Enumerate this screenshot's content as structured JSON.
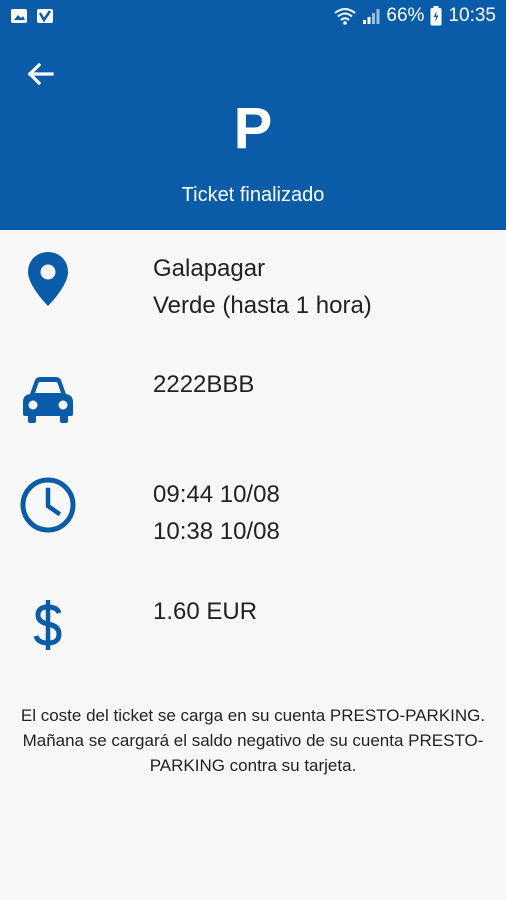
{
  "status_bar": {
    "battery": "66%",
    "time": "10:35"
  },
  "header": {
    "logo": "P",
    "title": "Ticket finalizado"
  },
  "ticket": {
    "location": {
      "city": "Galapagar",
      "zone": "Verde (hasta 1 hora)"
    },
    "vehicle": {
      "plate": "2222BBB"
    },
    "time": {
      "start": "09:44 10/08",
      "end": "10:38 10/08"
    },
    "cost": {
      "amount": "1.60 EUR"
    }
  },
  "note": "El coste del ticket se carga en su cuenta PRESTO-PARKING. Mañana se cargará el saldo negativo de su cuenta PRESTO-PARKING contra su tarjeta.",
  "colors": {
    "primary": "#0a5ca8",
    "background": "#f8f8f8"
  },
  "icons": [
    "back-arrow-icon",
    "location-pin-icon",
    "car-icon",
    "clock-icon",
    "dollar-icon"
  ]
}
